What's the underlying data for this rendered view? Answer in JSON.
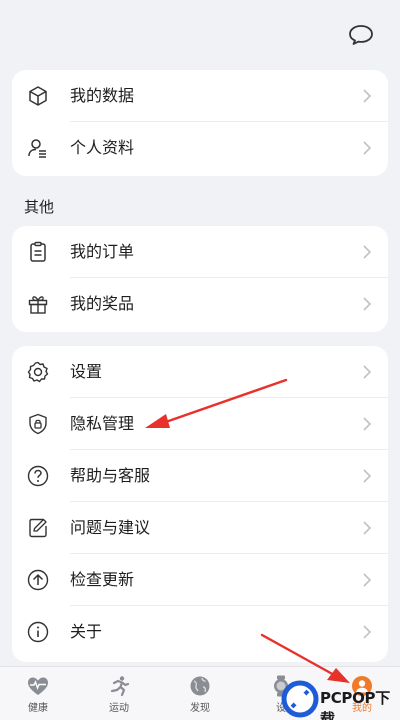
{
  "card1": {
    "items": [
      {
        "label": "我的数据",
        "icon": "cube-icon"
      },
      {
        "label": "个人资料",
        "icon": "person-icon"
      }
    ]
  },
  "section_other": {
    "title": "其他"
  },
  "card2": {
    "items": [
      {
        "label": "我的订单",
        "icon": "clipboard-icon"
      },
      {
        "label": "我的奖品",
        "icon": "gift-icon"
      }
    ]
  },
  "card3": {
    "items": [
      {
        "label": "设置",
        "icon": "gear-icon"
      },
      {
        "label": "隐私管理",
        "icon": "shield-lock-icon"
      },
      {
        "label": "帮助与客服",
        "icon": "question-icon"
      },
      {
        "label": "问题与建议",
        "icon": "edit-note-icon"
      },
      {
        "label": "检查更新",
        "icon": "arrow-up-circle-icon"
      },
      {
        "label": "关于",
        "icon": "info-icon"
      }
    ]
  },
  "tabbar": {
    "tabs": [
      {
        "label": "健康",
        "icon": "heart-pulse-icon"
      },
      {
        "label": "运动",
        "icon": "runner-icon"
      },
      {
        "label": "发现",
        "icon": "globe-icon"
      },
      {
        "label": "设",
        "icon": "watch-icon"
      },
      {
        "label": "我的",
        "icon": "profile-icon",
        "active": true
      }
    ]
  },
  "watermark": {
    "text": "PCPOP下载"
  },
  "colors": {
    "accent": "#f07a2a",
    "arrow": "#e8312b",
    "background": "#f1f2f6"
  }
}
